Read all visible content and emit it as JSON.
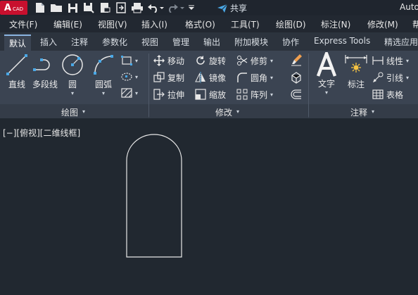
{
  "app": {
    "logo_letter": "A",
    "logo_text": "CAD",
    "window_title": "Auto",
    "share_label": "共享"
  },
  "quick_access": {
    "icons": [
      "new-file-icon",
      "open-folder-icon",
      "save-icon",
      "save-as-icon",
      "export-pdf-icon",
      "import-icon",
      "print-icon",
      "undo-icon",
      "redo-icon",
      "customize-dropdown-icon"
    ]
  },
  "menu": {
    "items": [
      "文件(F)",
      "编辑(E)",
      "视图(V)",
      "插入(I)",
      "格式(O)",
      "工具(T)",
      "绘图(D)",
      "标注(N)",
      "修改(M)",
      "帮"
    ]
  },
  "ribbon_tabs": {
    "items": [
      "默认",
      "插入",
      "注释",
      "参数化",
      "视图",
      "管理",
      "输出",
      "附加模块",
      "协作",
      "Express Tools",
      "精选应用"
    ],
    "active": "默认"
  },
  "panels": {
    "draw": {
      "title": "绘图",
      "line": "直线",
      "polyline": "多段线",
      "circle": "圆",
      "arc": "圆弧"
    },
    "modify": {
      "title": "修改",
      "move": "移动",
      "rotate": "旋转",
      "trim": "修剪",
      "copy": "复制",
      "mirror": "镜像",
      "fillet": "圆角",
      "stretch": "拉伸",
      "scale": "缩放",
      "array": "阵列"
    },
    "annotation": {
      "title": "注释",
      "text": "文字",
      "dimension": "标注",
      "linear": "线性",
      "leader": "引线",
      "table": "表格"
    }
  },
  "viewport": {
    "label": "[−][俯视][二维线框]"
  },
  "colors": {
    "accent_blue": "#8ab4e0",
    "logo_red": "#c8102e",
    "canvas_bg": "#212830",
    "ribbon_bg": "#3b4452",
    "drawing_stroke": "#e8e8e8"
  }
}
